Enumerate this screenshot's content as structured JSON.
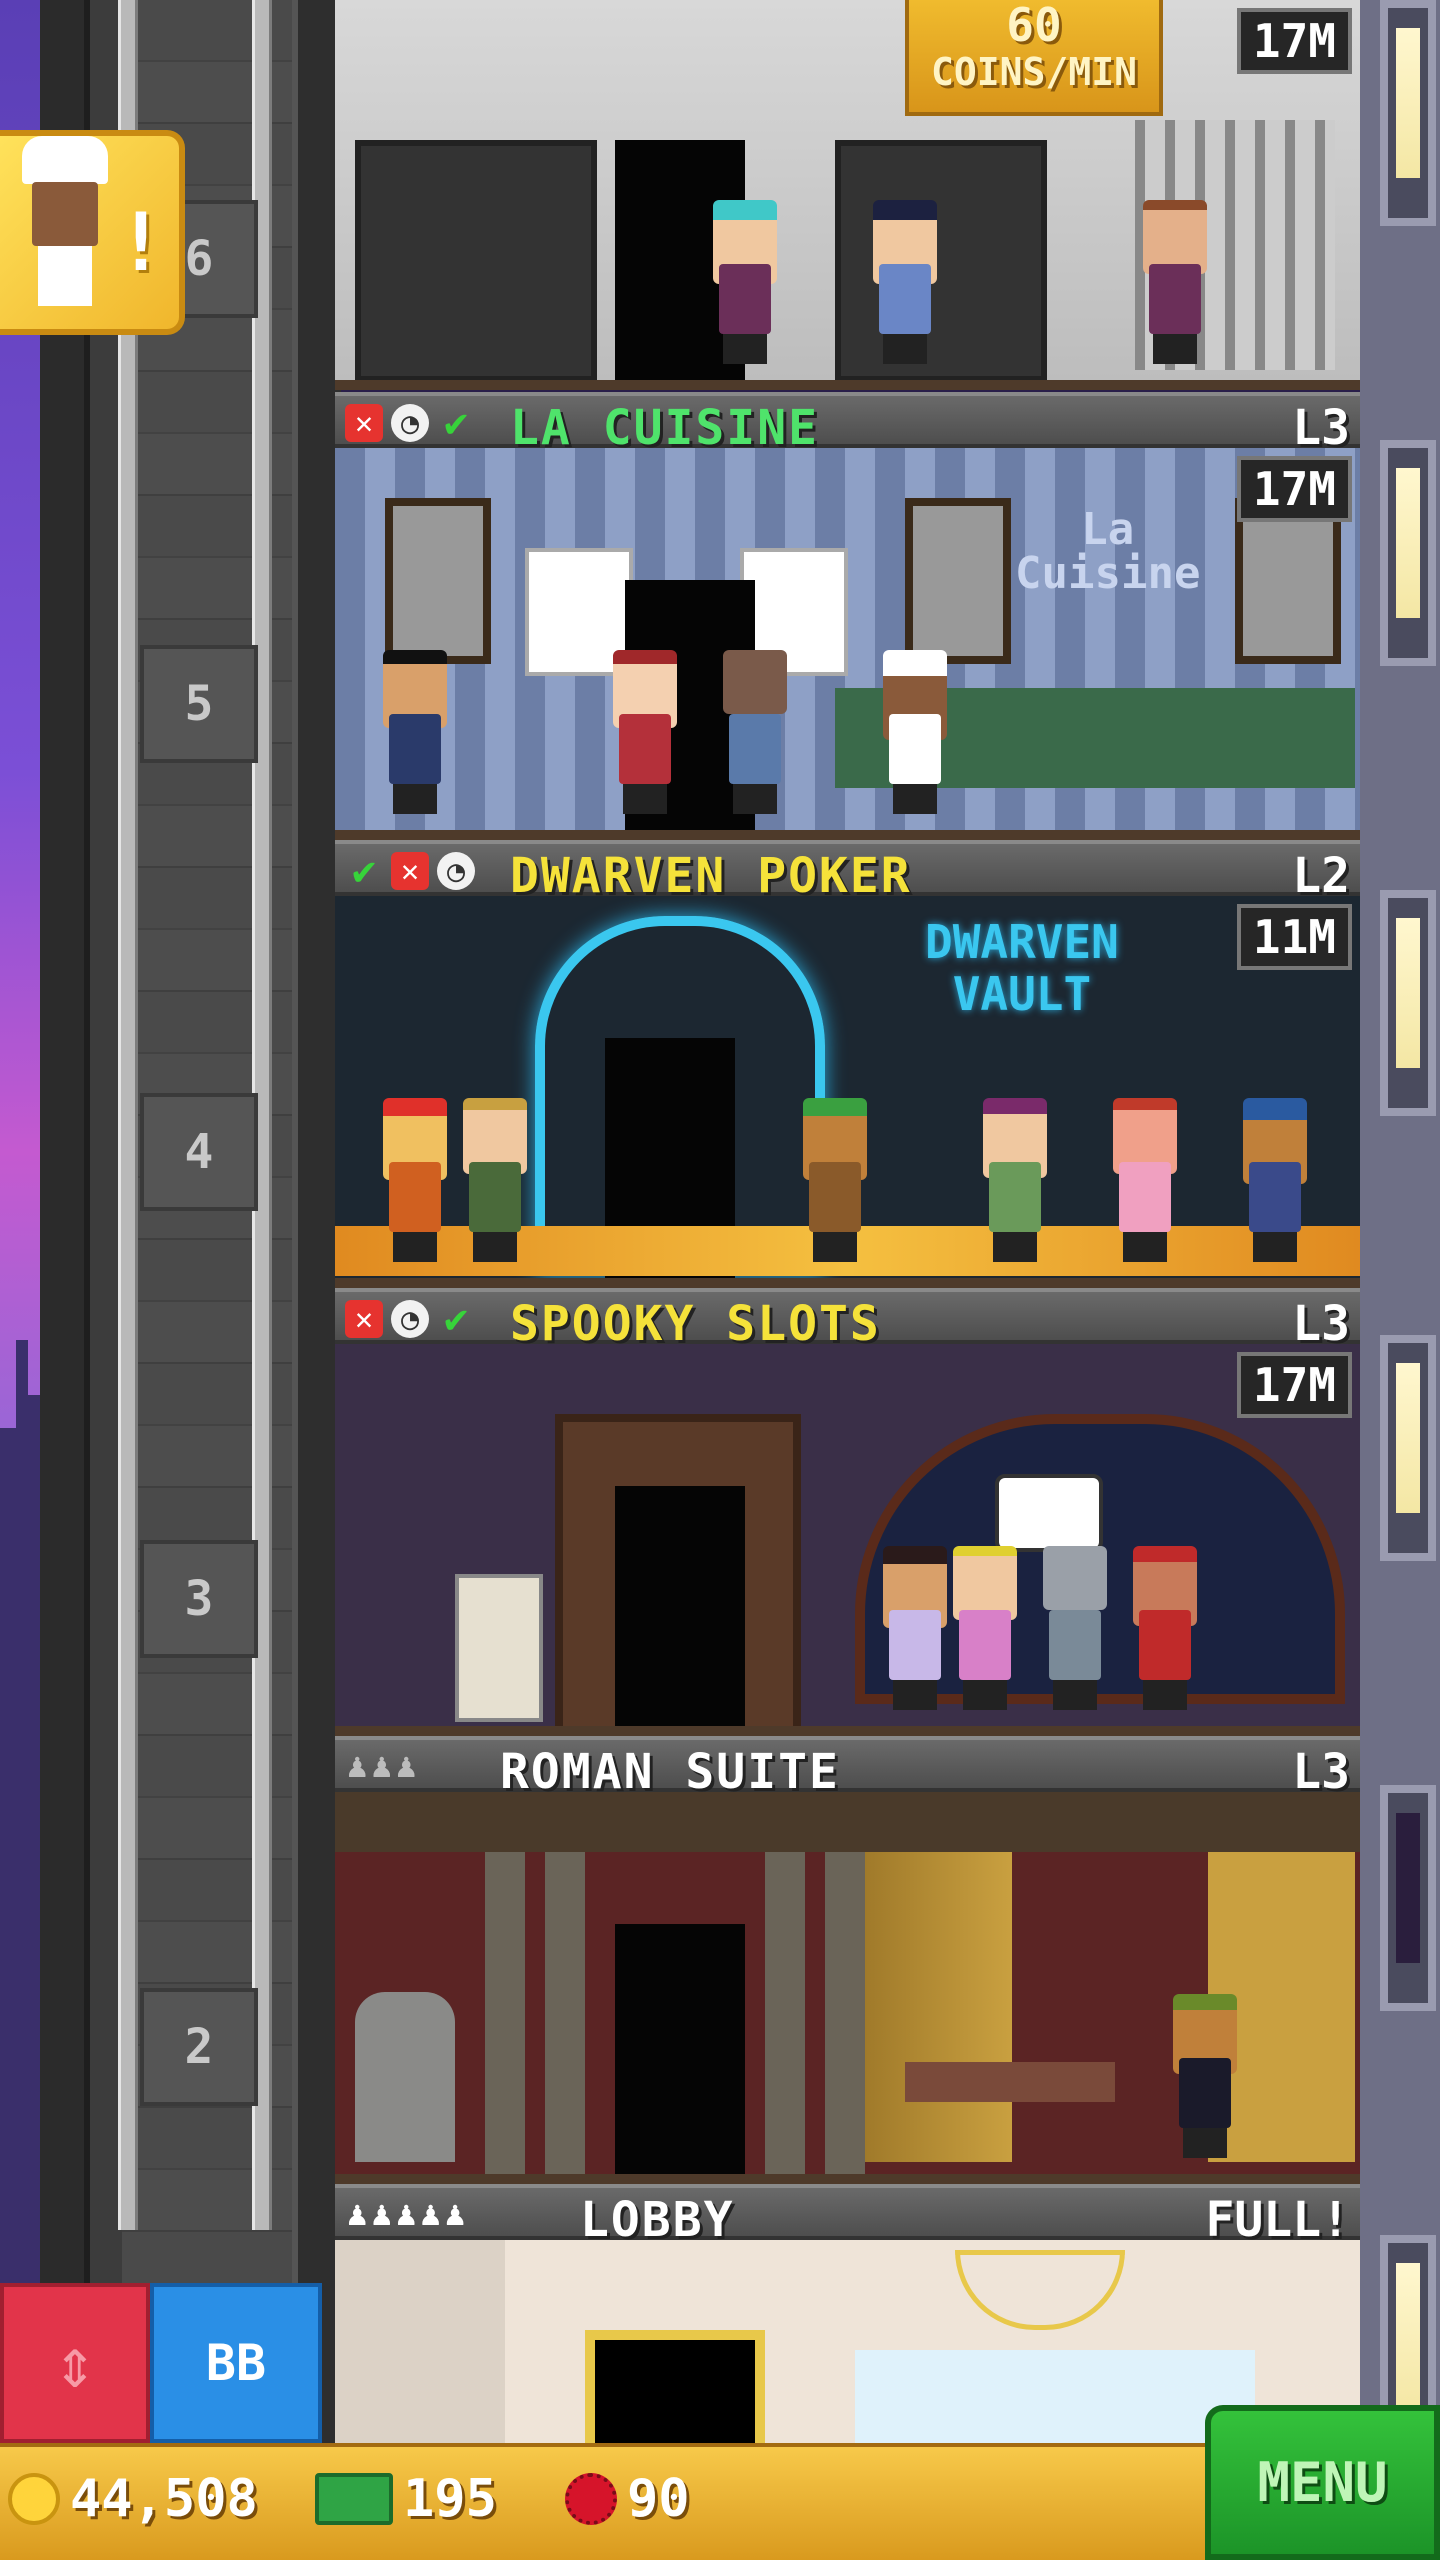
{
  "top_floor": {
    "coins_value": "60",
    "coins_unit": "COINS/MIN",
    "stock": "17M"
  },
  "floors": [
    {
      "name": "LA CUISINE",
      "level": "L3",
      "stock": "17M",
      "floor_number": "5",
      "title_color": "#4fe36b"
    },
    {
      "name": "DWARVEN POKER",
      "level": "L2",
      "stock": "11M",
      "floor_number": "4",
      "title_color": "#f5e23a"
    },
    {
      "name": "SPOOKY SLOTS",
      "level": "L3",
      "stock": "17M",
      "floor_number": "3",
      "title_color": "#f5e23a"
    },
    {
      "name": "ROMAN SUITE",
      "level": "L3",
      "floor_number": "2",
      "title_color": "#ffffff"
    },
    {
      "name": "LOBBY",
      "level": "FULL!",
      "title_color": "#ffffff"
    }
  ],
  "shaft_top_number": "6",
  "signs": {
    "dwarven_vault_1": "DWARVEN",
    "dwarven_vault_2": "VAULT",
    "la_cuisine_1": "La",
    "la_cuisine_2": "Cuisine"
  },
  "controls": {
    "bb_label": "BB",
    "menu_label": "MENU"
  },
  "resources": {
    "coins": "44,508",
    "bux": "195",
    "gems": "90"
  },
  "colors": {
    "menu": "#2cb233",
    "elevator_button": "#e2344a",
    "bb_button": "#2a8fe6",
    "bottom_bar": "#eebd3c"
  }
}
